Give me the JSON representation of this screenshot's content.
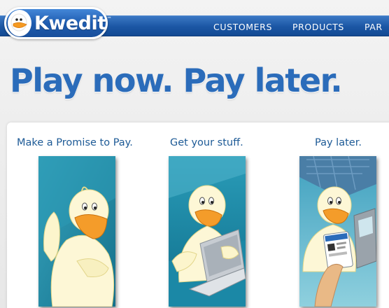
{
  "brand": {
    "name": "Kwedit",
    "trademark": "™"
  },
  "nav": {
    "items": [
      "CUSTOMERS",
      "PRODUCTS",
      "PAR"
    ]
  },
  "hero": {
    "headline": "Play now. Pay later."
  },
  "steps": [
    {
      "title": "Make a Promise to Pay."
    },
    {
      "title": "Get your stuff."
    },
    {
      "title": "Pay later."
    }
  ],
  "colors": {
    "nav_blue": "#1b56a4",
    "headline_blue": "#2b6cba",
    "step_title": "#1d5a96",
    "teal": "#1f8fa8"
  },
  "icons": [
    "duck-logo-icon",
    "duck-illustration"
  ]
}
